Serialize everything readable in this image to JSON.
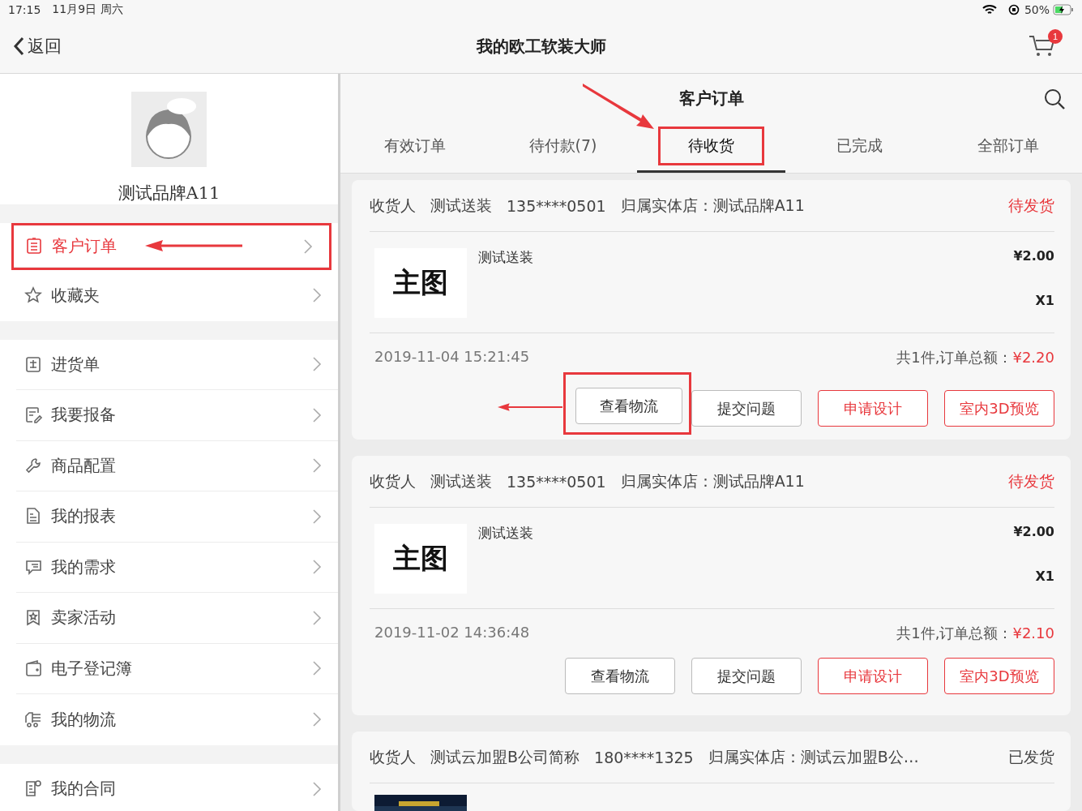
{
  "status_bar": {
    "time": "17:15",
    "date": "11月9日 周六",
    "battery": "50%"
  },
  "nav": {
    "back": "返回",
    "title": "我的欧工软装大师",
    "cart_badge": "1"
  },
  "sidebar": {
    "profile_name": "测试品牌A11",
    "groups": [
      [
        {
          "label": "客户订单",
          "selected": true,
          "annotated": true
        },
        {
          "label": "收藏夹",
          "selected": false,
          "annotated": false
        }
      ],
      [
        {
          "label": "进货单",
          "selected": false,
          "annotated": false
        },
        {
          "label": "我要报备",
          "selected": false,
          "annotated": false
        },
        {
          "label": "商品配置",
          "selected": false,
          "annotated": false
        },
        {
          "label": "我的报表",
          "selected": false,
          "annotated": false
        },
        {
          "label": "我的需求",
          "selected": false,
          "annotated": false
        },
        {
          "label": "卖家活动",
          "selected": false,
          "annotated": false
        },
        {
          "label": "电子登记簿",
          "selected": false,
          "annotated": false
        },
        {
          "label": "我的物流",
          "selected": false,
          "annotated": false
        }
      ],
      [
        {
          "label": "我的合同",
          "selected": false,
          "annotated": false
        }
      ]
    ]
  },
  "panel": {
    "title": "客户订单",
    "tabs": [
      {
        "label": "有效订单",
        "selected": false,
        "annotated": false
      },
      {
        "label": "待付款(7)",
        "selected": false,
        "annotated": false
      },
      {
        "label": "待收货",
        "selected": true,
        "annotated": true
      },
      {
        "label": "已完成",
        "selected": false,
        "annotated": false
      },
      {
        "label": "全部订单",
        "selected": false,
        "annotated": false
      }
    ],
    "orders": [
      {
        "receiver_label": "收货人",
        "receiver": "测试送装",
        "phone": "135****0501",
        "store": "归属实体店：测试品牌A11",
        "status": "待发货",
        "kind": "pending",
        "product": {
          "thumb": "主图",
          "name": "测试送装",
          "price": "¥2.00",
          "qty": "X1"
        },
        "date": "2019-11-04 15:21:45",
        "total_label": "共1件,订单总额：",
        "total": "¥2.20",
        "buttons": [
          {
            "label": "查看物流",
            "kind": "plain",
            "annotated": true
          },
          {
            "label": "提交问题",
            "kind": "plain",
            "annotated": false
          },
          {
            "label": "申请设计",
            "kind": "accent",
            "annotated": false
          },
          {
            "label": "室内3D预览",
            "kind": "accent",
            "annotated": false
          }
        ]
      },
      {
        "receiver_label": "收货人",
        "receiver": "测试送装",
        "phone": "135****0501",
        "store": "归属实体店：测试品牌A11",
        "status": "待发货",
        "kind": "pending",
        "product": {
          "thumb": "主图",
          "name": "测试送装",
          "price": "¥2.00",
          "qty": "X1"
        },
        "date": "2019-11-02 14:36:48",
        "total_label": "共1件,订单总额：",
        "total": "¥2.10",
        "buttons": [
          {
            "label": "查看物流",
            "kind": "plain",
            "annotated": false
          },
          {
            "label": "提交问题",
            "kind": "plain",
            "annotated": false
          },
          {
            "label": "申请设计",
            "kind": "accent",
            "annotated": false
          },
          {
            "label": "室内3D预览",
            "kind": "accent",
            "annotated": false
          }
        ]
      },
      {
        "receiver_label": "收货人",
        "receiver": "测试云加盟B公司简称",
        "phone": "180****1325",
        "store": "归属实体店：测试云加盟B公…",
        "status": "已发货",
        "kind": "shipped"
      }
    ]
  }
}
